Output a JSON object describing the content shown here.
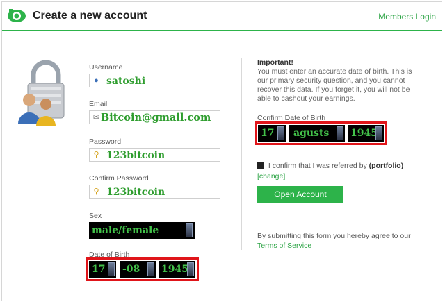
{
  "header": {
    "title": "Create a new account",
    "members_login": "Members Login"
  },
  "form": {
    "username": {
      "label": "Username",
      "value": "satoshi"
    },
    "email": {
      "label": "Email",
      "value": "Bitcoin@gmail.com"
    },
    "password": {
      "label": "Password",
      "value": "123bitcoin"
    },
    "confirm_password": {
      "label": "Confirm Password",
      "value": "123bitcoin"
    },
    "sex": {
      "label": "Sex",
      "value": "male/female"
    },
    "dob": {
      "label": "Date of Birth",
      "day": "17",
      "month": "-08",
      "year": "1945"
    }
  },
  "right": {
    "important_title": "Important!",
    "important_text": "You must enter an accurate date of birth. This is our primary security question, and you cannot recover this data. If you forget it, you will not be able to cashout your earnings.",
    "confirm_dob": {
      "label": "Confirm Date of Birth",
      "day": "17",
      "month": "agusts",
      "year": "1945"
    },
    "referred_text": "I confirm that I was referred by",
    "referrer": "(portfolio)",
    "change": "[change]",
    "open_account": "Open Account",
    "terms_prefix": "By submitting this form you hereby agree to our",
    "terms_link": "Terms of Service"
  },
  "colors": {
    "accent": "#2db34a",
    "highlight": "#e0151a"
  }
}
